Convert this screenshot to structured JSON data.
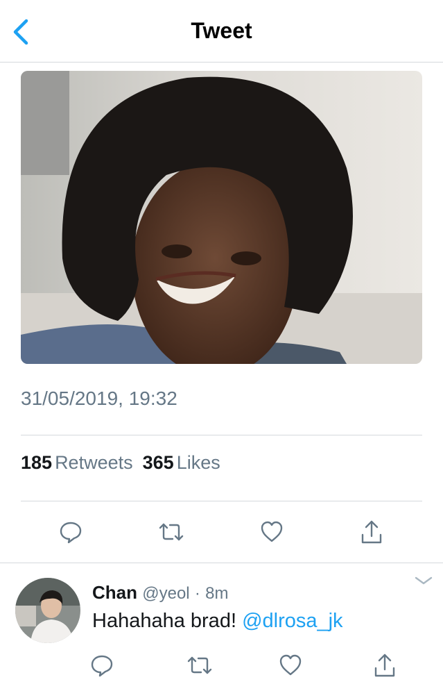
{
  "header": {
    "title": "Tweet",
    "back_icon": "chevron-left-icon"
  },
  "tweet": {
    "media_description": "photo",
    "timestamp": "31/05/2019, 19:32",
    "stats": {
      "retweets_count": "185",
      "retweets_label": "Retweets",
      "likes_count": "365",
      "likes_label": "Likes"
    },
    "actions": [
      "reply-icon",
      "retweet-icon",
      "like-icon",
      "share-icon"
    ]
  },
  "reply": {
    "name": "Chan",
    "handle": "@yeol",
    "dot": "·",
    "time": "8m",
    "text": "Hahahaha brad! ",
    "mention": "@dlrosa_jk"
  },
  "colors": {
    "accent": "#1da1f2",
    "secondary_text": "#657786",
    "divider": "#d4d8dc",
    "primary_text": "#14171a"
  }
}
